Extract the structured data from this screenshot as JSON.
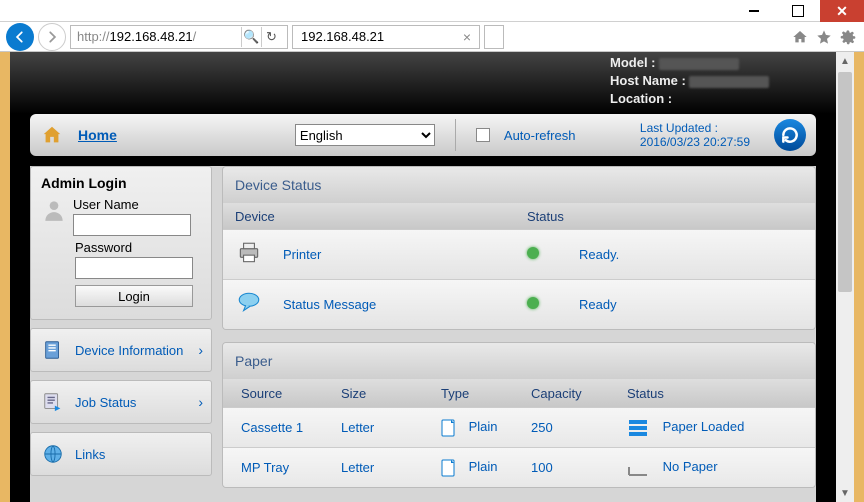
{
  "window": {
    "title_ip": "192.168.48.21"
  },
  "address_bar": {
    "prefix": "http://",
    "host": "192.168.48.21",
    "suffix": "/"
  },
  "device_meta": {
    "model_label": "Model :",
    "hostname_label": "Host Name :",
    "location_label": "Location :"
  },
  "toolbar": {
    "home_label": "Home",
    "language_value": "English",
    "autorefresh_label": "Auto-refresh",
    "last_updated_label": "Last Updated :",
    "last_updated_value": "2016/03/23 20:27:59"
  },
  "sidebar": {
    "login_title": "Admin Login",
    "username_label": "User Name",
    "password_label": "Password",
    "login_button": "Login",
    "items": [
      {
        "label": "Device Information",
        "has_chevron": true
      },
      {
        "label": "Job Status",
        "has_chevron": true
      },
      {
        "label": "Links",
        "has_chevron": false
      }
    ]
  },
  "device_status": {
    "title": "Device Status",
    "col_device": "Device",
    "col_status": "Status",
    "rows": [
      {
        "name": "Printer",
        "status": "Ready."
      },
      {
        "name": "Status Message",
        "status": "Ready"
      }
    ]
  },
  "paper": {
    "title": "Paper",
    "cols": {
      "source": "Source",
      "size": "Size",
      "type": "Type",
      "capacity": "Capacity",
      "status": "Status"
    },
    "rows": [
      {
        "source": "Cassette 1",
        "size": "Letter",
        "type": "Plain",
        "capacity": "250",
        "status": "Paper Loaded"
      },
      {
        "source": "MP Tray",
        "size": "Letter",
        "type": "Plain",
        "capacity": "100",
        "status": "No Paper"
      }
    ]
  }
}
